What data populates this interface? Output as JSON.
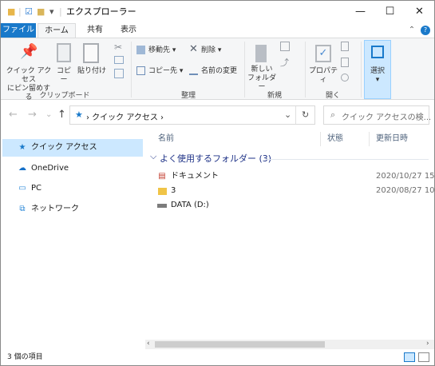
{
  "window": {
    "title": "エクスプローラー",
    "quick_access_toolbar": [
      "■",
      "☑",
      "■",
      "▾"
    ],
    "minimize_glyph": "—",
    "maximize_glyph": "☐",
    "close_glyph": "✕"
  },
  "ribbon": {
    "tabs": [
      "ファイル",
      "ホーム",
      "共有",
      "表示"
    ],
    "collapse_glyph": "⌃",
    "help_glyph": "?",
    "clipboard": {
      "pin_label": "クイック アクセス\nにピン留めする",
      "copy_label": "コピー",
      "paste_label": "貼り付け",
      "group_label": "クリップボード"
    },
    "organize": {
      "move_label": "移動先 ▾",
      "copy_to_label": "コピー先 ▾",
      "delete_label": "削除 ▾",
      "rename_label": "名前の変更",
      "group_label": "整理"
    },
    "new": {
      "new_folder_label": "新しい\nフォルダー",
      "group_label": "新規"
    },
    "open": {
      "properties_label": "プロパティ",
      "group_label": "開く"
    },
    "select": {
      "select_label": "選択"
    }
  },
  "address_bar": {
    "back": "←",
    "forward": "→",
    "recent": "⌄",
    "up": "↑",
    "path": "› クイック アクセス ›",
    "dropdown": "⌄",
    "refresh": "↻",
    "search_placeholder": "クイック アクセスの検..."
  },
  "navigation": [
    {
      "label": "クイック アクセス",
      "icon": "star-icon",
      "selected": true
    },
    {
      "label": "OneDrive",
      "icon": "cloud-icon",
      "selected": false
    },
    {
      "label": "PC",
      "icon": "computer-icon",
      "selected": false
    },
    {
      "label": "ネットワーク",
      "icon": "network-icon",
      "selected": false
    }
  ],
  "columns": {
    "name": "名前",
    "status": "状態",
    "modified": "更新日時"
  },
  "group": {
    "title": "よく使用するフォルダー (3)",
    "chevron": "⌵"
  },
  "items": [
    {
      "name": "ドキュメント",
      "icon": "documents-icon",
      "date": "2020/10/27 15:"
    },
    {
      "name": "3",
      "icon": "folder-icon",
      "date": "2020/08/27 10:"
    },
    {
      "name": "DATA (D:)",
      "icon": "drive-icon",
      "date": ""
    }
  ],
  "status_bar": {
    "count": "3 個の項目"
  },
  "colors": {
    "accent": "#1979ca",
    "selected_nav": "#cce8ff",
    "group_title": "#1e3287"
  }
}
